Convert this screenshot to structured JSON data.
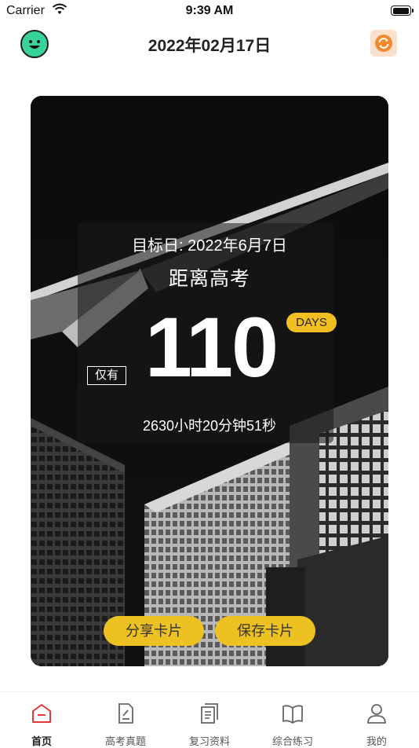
{
  "status": {
    "carrier": "Carrier",
    "time": "9:39 AM"
  },
  "header": {
    "title": "2022年02月17日"
  },
  "card": {
    "target_date": "目标日: 2022年6月7日",
    "subtitle": "距离高考",
    "days_badge": "DAYS",
    "days_count": "110",
    "only_label": "仅有",
    "remaining_time": "2630小时20分钟51秒",
    "share_button": "分享卡片",
    "save_button": "保存卡片"
  },
  "tabs": [
    {
      "label": "首页",
      "icon": "home-icon",
      "active": true
    },
    {
      "label": "高考真题",
      "icon": "document-edit-icon",
      "active": false
    },
    {
      "label": "复习资料",
      "icon": "documents-icon",
      "active": false
    },
    {
      "label": "综合练习",
      "icon": "book-icon",
      "active": false
    },
    {
      "label": "我的",
      "icon": "user-icon",
      "active": false
    }
  ],
  "colors": {
    "accent_yellow": "#eec122",
    "tab_active": "#e23a3a",
    "avatar_green": "#36d39a"
  }
}
